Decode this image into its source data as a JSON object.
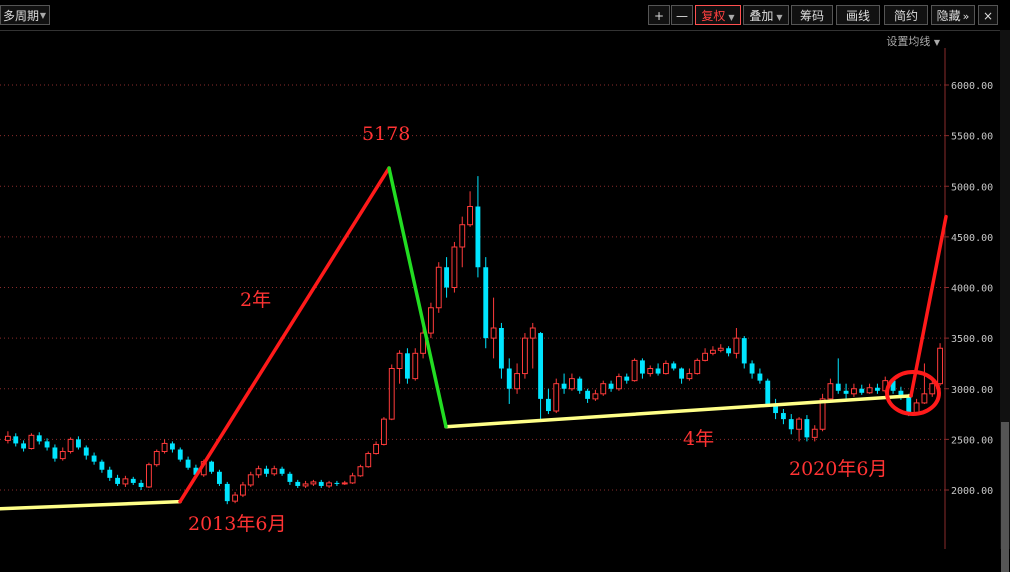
{
  "toolbar": {
    "period": "多周期",
    "plus": "+",
    "minus": "—",
    "restore": "复权",
    "overlay": "叠加",
    "chips": "筹码",
    "draw": "画线",
    "simple": "简约",
    "hide": "隐藏",
    "expand": "»",
    "close": "×",
    "ma_setting": "设置均线"
  },
  "bottom_legend": "",
  "colors": {
    "up": "#ff3b3b",
    "down": "#00e5ff",
    "grid": "#8a2b2b",
    "red_line": "#ff1a1a",
    "green_line": "#22dd22",
    "yellow_line": "#ffff88"
  },
  "chart_data": {
    "type": "candlestick",
    "ylim": [
      1750,
      6300
    ],
    "ticks": [
      2000,
      2500,
      3000,
      3500,
      4000,
      4500,
      5000,
      5500,
      6000
    ],
    "tick_labels": [
      "2000.00",
      "2500.00",
      "3000.00",
      "3500.00",
      "4000.00",
      "4500.00",
      "5000.00",
      "5500.00",
      "6000.00"
    ],
    "candles": [
      [
        2490,
        2530,
        2580,
        2460
      ],
      [
        2530,
        2460,
        2560,
        2430
      ],
      [
        2460,
        2410,
        2490,
        2380
      ],
      [
        2410,
        2540,
        2560,
        2400
      ],
      [
        2540,
        2480,
        2570,
        2450
      ],
      [
        2480,
        2420,
        2510,
        2390
      ],
      [
        2420,
        2310,
        2450,
        2280
      ],
      [
        2310,
        2380,
        2420,
        2290
      ],
      [
        2380,
        2500,
        2520,
        2360
      ],
      [
        2500,
        2420,
        2530,
        2400
      ],
      [
        2420,
        2340,
        2440,
        2300
      ],
      [
        2340,
        2280,
        2370,
        2250
      ],
      [
        2280,
        2200,
        2300,
        2170
      ],
      [
        2200,
        2120,
        2230,
        2090
      ],
      [
        2120,
        2060,
        2150,
        2040
      ],
      [
        2060,
        2110,
        2140,
        2030
      ],
      [
        2110,
        2070,
        2130,
        2050
      ],
      [
        2070,
        2030,
        2100,
        2000
      ],
      [
        2030,
        2250,
        2270,
        2020
      ],
      [
        2250,
        2380,
        2400,
        2230
      ],
      [
        2380,
        2460,
        2500,
        2360
      ],
      [
        2460,
        2400,
        2480,
        2370
      ],
      [
        2400,
        2300,
        2420,
        2280
      ],
      [
        2300,
        2220,
        2330,
        2200
      ],
      [
        2220,
        2150,
        2250,
        2120
      ],
      [
        2150,
        2280,
        2300,
        2130
      ],
      [
        2280,
        2180,
        2290,
        2160
      ],
      [
        2180,
        2060,
        2200,
        2040
      ],
      [
        2060,
        1890,
        2080,
        1860
      ],
      [
        1890,
        1950,
        1980,
        1870
      ],
      [
        1950,
        2050,
        2080,
        1930
      ],
      [
        2050,
        2150,
        2180,
        2030
      ],
      [
        2150,
        2210,
        2240,
        2120
      ],
      [
        2210,
        2160,
        2240,
        2130
      ],
      [
        2160,
        2210,
        2240,
        2140
      ],
      [
        2210,
        2160,
        2230,
        2140
      ],
      [
        2160,
        2080,
        2180,
        2050
      ],
      [
        2080,
        2040,
        2100,
        2020
      ],
      [
        2040,
        2060,
        2090,
        2020
      ],
      [
        2060,
        2080,
        2100,
        2040
      ],
      [
        2080,
        2040,
        2100,
        2020
      ],
      [
        2040,
        2070,
        2090,
        2020
      ],
      [
        2070,
        2060,
        2090,
        2040
      ],
      [
        2060,
        2070,
        2090,
        2050
      ],
      [
        2070,
        2140,
        2170,
        2060
      ],
      [
        2140,
        2230,
        2250,
        2130
      ],
      [
        2230,
        2360,
        2380,
        2220
      ],
      [
        2360,
        2450,
        2480,
        2350
      ],
      [
        2450,
        2700,
        2720,
        2440
      ],
      [
        2700,
        3200,
        3240,
        2690
      ],
      [
        3200,
        3350,
        3380,
        3050
      ],
      [
        3350,
        3100,
        3400,
        3050
      ],
      [
        3100,
        3350,
        3400,
        3080
      ],
      [
        3350,
        3550,
        3600,
        3300
      ],
      [
        3550,
        3800,
        3850,
        3500
      ],
      [
        3800,
        4200,
        4250,
        3750
      ],
      [
        4200,
        4000,
        4300,
        3900
      ],
      [
        4000,
        4400,
        4450,
        3950
      ],
      [
        4400,
        4620,
        4700,
        4200
      ],
      [
        4620,
        4800,
        4950,
        4600
      ],
      [
        4800,
        4200,
        5100,
        4100
      ],
      [
        4200,
        3500,
        4300,
        3400
      ],
      [
        3500,
        3600,
        3900,
        3300
      ],
      [
        3600,
        3200,
        3650,
        3100
      ],
      [
        3200,
        3000,
        3300,
        2850
      ],
      [
        3000,
        3150,
        3250,
        2950
      ],
      [
        3150,
        3500,
        3550,
        3100
      ],
      [
        3500,
        3600,
        3650,
        3200
      ],
      [
        3550,
        2900,
        3560,
        2700
      ],
      [
        2900,
        2780,
        3000,
        2750
      ],
      [
        2780,
        3050,
        3100,
        2760
      ],
      [
        3050,
        3000,
        3150,
        2950
      ],
      [
        3000,
        3100,
        3150,
        2980
      ],
      [
        3100,
        2980,
        3120,
        2950
      ],
      [
        2980,
        2900,
        3000,
        2860
      ],
      [
        2900,
        2950,
        2990,
        2880
      ],
      [
        2950,
        3050,
        3080,
        2930
      ],
      [
        3050,
        3000,
        3080,
        2970
      ],
      [
        3000,
        3120,
        3150,
        2980
      ],
      [
        3120,
        3080,
        3150,
        3050
      ],
      [
        3080,
        3280,
        3300,
        3070
      ],
      [
        3280,
        3150,
        3300,
        3100
      ],
      [
        3150,
        3200,
        3230,
        3120
      ],
      [
        3200,
        3150,
        3250,
        3130
      ],
      [
        3150,
        3250,
        3280,
        3140
      ],
      [
        3250,
        3200,
        3270,
        3180
      ],
      [
        3200,
        3100,
        3210,
        3050
      ],
      [
        3100,
        3150,
        3200,
        3080
      ],
      [
        3150,
        3280,
        3300,
        3140
      ],
      [
        3280,
        3350,
        3400,
        3270
      ],
      [
        3350,
        3380,
        3420,
        3330
      ],
      [
        3380,
        3400,
        3440,
        3360
      ],
      [
        3400,
        3350,
        3420,
        3320
      ],
      [
        3350,
        3500,
        3600,
        3300
      ],
      [
        3500,
        3250,
        3520,
        3200
      ],
      [
        3250,
        3150,
        3280,
        3100
      ],
      [
        3150,
        3080,
        3200,
        3050
      ],
      [
        3080,
        2850,
        3100,
        2820
      ],
      [
        2850,
        2760,
        2900,
        2700
      ],
      [
        2760,
        2700,
        2800,
        2650
      ],
      [
        2700,
        2600,
        2750,
        2550
      ],
      [
        2600,
        2700,
        2720,
        2480
      ],
      [
        2700,
        2520,
        2740,
        2480
      ],
      [
        2520,
        2600,
        2640,
        2480
      ],
      [
        2600,
        2900,
        2950,
        2580
      ],
      [
        2900,
        3050,
        3100,
        2880
      ],
      [
        3050,
        2980,
        3300,
        2950
      ],
      [
        2980,
        2950,
        3050,
        2900
      ],
      [
        2950,
        3000,
        3050,
        2920
      ],
      [
        3000,
        2960,
        3040,
        2940
      ],
      [
        2960,
        3010,
        3050,
        2950
      ],
      [
        3010,
        2980,
        3050,
        2950
      ],
      [
        2980,
        3080,
        3120,
        2960
      ],
      [
        3080,
        2980,
        3100,
        2950
      ],
      [
        2980,
        2920,
        3020,
        2890
      ],
      [
        2920,
        2760,
        2950,
        2730
      ],
      [
        2760,
        2860,
        2900,
        2750
      ],
      [
        2860,
        2950,
        3250,
        2850
      ],
      [
        2950,
        3050,
        3100,
        2920
      ],
      [
        3050,
        3400,
        3450,
        3030
      ]
    ],
    "trend_lines": [
      {
        "color": "#ffff88",
        "points": [
          [
            0,
            1815
          ],
          [
            28,
            1885
          ]
        ]
      },
      {
        "color": "#ffff88",
        "points": [
          [
            69,
            2625
          ],
          [
            112,
            2930
          ]
        ]
      },
      {
        "color": "#ff1a1a",
        "points": [
          [
            28,
            1885
          ],
          [
            60,
            5180
          ]
        ]
      },
      {
        "color": "#22dd22",
        "points": [
          [
            60,
            5180
          ],
          [
            69,
            2625
          ]
        ]
      },
      {
        "color": "#ff1a1a",
        "points": [
          [
            112,
            2930
          ],
          [
            119,
            4700
          ]
        ]
      }
    ],
    "annotations": [
      {
        "text": "5178",
        "color": "#ff3333"
      },
      {
        "text": "2年",
        "color": "#ff3333"
      },
      {
        "text": "2013年6月",
        "color": "#ff3333"
      },
      {
        "text": "4年",
        "color": "#ff3333"
      },
      {
        "text": "2020年6月",
        "color": "#ff3333"
      }
    ]
  }
}
